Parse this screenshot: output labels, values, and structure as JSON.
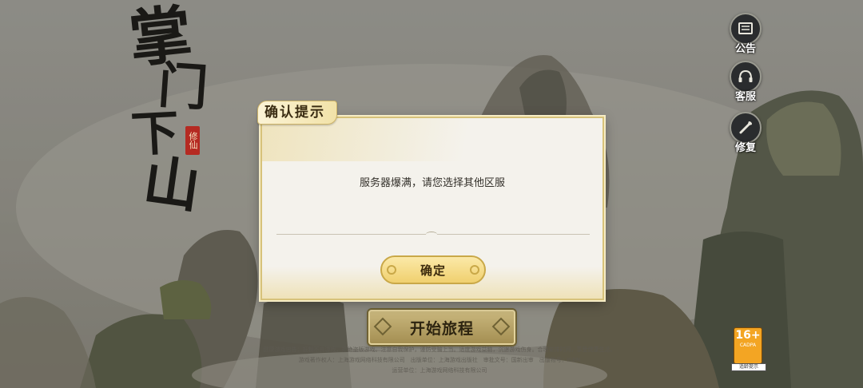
{
  "logo": {
    "chars": [
      "掌",
      "门",
      "下",
      "山"
    ],
    "seal": "修仙"
  },
  "side_menu": {
    "notice_label": "公告",
    "service_label": "客服",
    "repair_label": "修复"
  },
  "age_badge": {
    "rating": "16+",
    "org": "CADPA",
    "label": "适龄提示"
  },
  "start_button": {
    "label": "开始旅程"
  },
  "legal": {
    "line1": "健康游戏忠告：抵制不良游戏，拒绝盗版游戏。注意自我保护，谨防受骗上当。适度游戏益脑，沉迷游戏伤身。合理安排时间，享受健康生活。",
    "line2": "游戏著作权人：上海游戏网络科技有限公司　出版单位：上海游戏出版社　审批文号：国新出审　出版物号：ISBN",
    "line3": "运营单位：上海游戏网络科技有限公司"
  },
  "dialog": {
    "title": "确认提示",
    "message": "服务器爆满，请您选择其他区服",
    "confirm_label": "确定"
  },
  "colors": {
    "dialog_bg": "#f4f2ec",
    "dialog_border": "#d7c27a",
    "confirm_bg": "#f0d06f",
    "start_bg": "#b8a466"
  }
}
